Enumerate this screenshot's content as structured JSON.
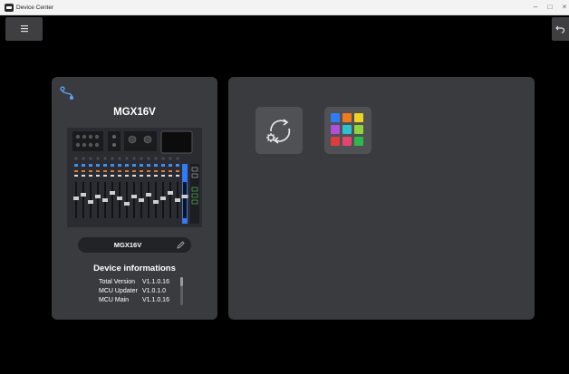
{
  "window": {
    "title": "Device Center",
    "minimize_glyph": "–",
    "maximize_glyph": "□",
    "close_glyph": "×"
  },
  "toolbar": {
    "menu_icon": "hamburger-menu-icon",
    "back_icon": "back-arrow-icon"
  },
  "device_card": {
    "connection_icon": "connection-icon",
    "model": "MGX16V",
    "device_name": "MGX16V",
    "edit_icon": "pencil-icon",
    "info_title": "Device informations",
    "info": [
      {
        "label": "Total Version",
        "value": "V1.1.0.16"
      },
      {
        "label": "MCU Updater",
        "value": "V1.0.1.0"
      },
      {
        "label": "MCU Main",
        "value": "V1.1.0.16"
      }
    ]
  },
  "tools": [
    {
      "name": "firmware-update",
      "icon": "sync-gear-icon"
    },
    {
      "name": "apps",
      "icon": "app-grid-icon",
      "colors": [
        "#2f7df6",
        "#f07a1a",
        "#f2d21b",
        "#b54ddb",
        "#27c3cf",
        "#8ed43a",
        "#e23b3b",
        "#e8436f",
        "#2fb84a"
      ]
    }
  ]
}
